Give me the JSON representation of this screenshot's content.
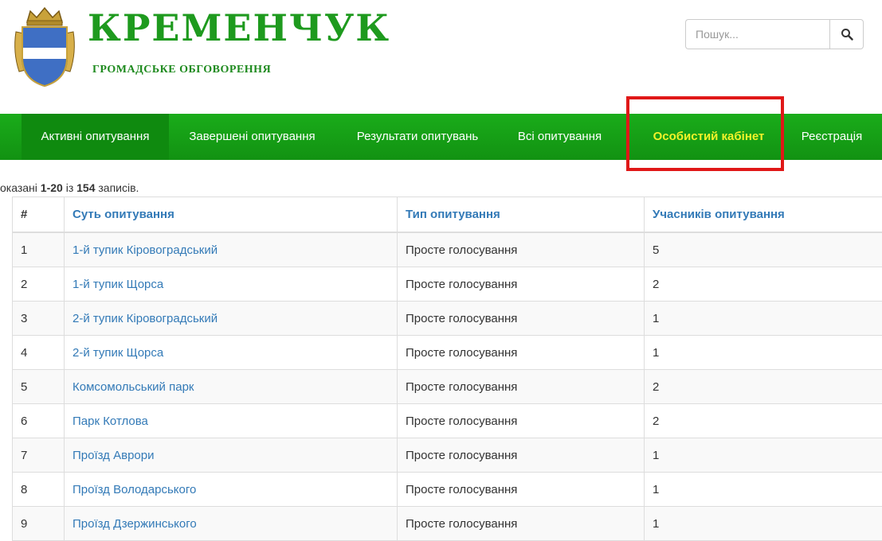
{
  "header": {
    "title": "КРЕМЕНЧУК",
    "subtitle": "ГРОМАДСЬКЕ ОБГОВОРЕННЯ",
    "search_placeholder": "Пошук..."
  },
  "nav": {
    "items": [
      {
        "label": "Активні опитування"
      },
      {
        "label": "Завершені опитування"
      },
      {
        "label": "Результати опитувань"
      },
      {
        "label": "Всі опитування"
      },
      {
        "label": "Особистий кабінет"
      },
      {
        "label": "Реєстрація"
      }
    ]
  },
  "summary": {
    "prefix": "оказані",
    "range": "1-20",
    "middle": "із",
    "total": "154",
    "suffix": "записів."
  },
  "table": {
    "headers": [
      "#",
      "Суть опитування",
      "Тип опитування",
      "Учасників опитування"
    ],
    "rows": [
      {
        "num": "1",
        "title": "1-й тупик Кіровоградський",
        "type": "Просте голосування",
        "participants": "5"
      },
      {
        "num": "2",
        "title": "1-й тупик Щорса",
        "type": "Просте голосування",
        "participants": "2"
      },
      {
        "num": "3",
        "title": "2-й тупик Кіровоградський",
        "type": "Просте голосування",
        "participants": "1"
      },
      {
        "num": "4",
        "title": "2-й тупик Щорса",
        "type": "Просте голосування",
        "participants": "1"
      },
      {
        "num": "5",
        "title": "Комсомольський парк",
        "type": "Просте голосування",
        "participants": "2"
      },
      {
        "num": "6",
        "title": "Парк Котлова",
        "type": "Просте голосування",
        "participants": "2"
      },
      {
        "num": "7",
        "title": "Проїзд Аврори",
        "type": "Просте голосування",
        "participants": "1"
      },
      {
        "num": "8",
        "title": "Проїзд Володарського",
        "type": "Просте голосування",
        "participants": "1"
      },
      {
        "num": "9",
        "title": "Проїзд Дзержинського",
        "type": "Просте голосування",
        "participants": "1"
      }
    ]
  },
  "colors": {
    "brand_green": "#1e9a1e",
    "navbar": "#17a317",
    "active_highlight": "#f2f22a",
    "link": "#337ab7",
    "annotation_red": "#e01818"
  }
}
